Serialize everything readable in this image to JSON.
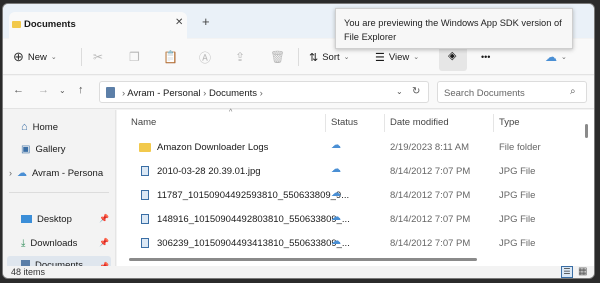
{
  "tab": {
    "title": "Documents",
    "close": "✕",
    "new_tab": "+"
  },
  "tooltip": {
    "text": "You are previewing the Windows App SDK version of File Explorer"
  },
  "toolbar": {
    "new_label": "New",
    "sort_label": "Sort",
    "view_label": "View",
    "more": "•••"
  },
  "address": {
    "back": "←",
    "forward": "→",
    "up": "↑",
    "crumb1": "Avram - Personal",
    "crumb2": "Documents",
    "search_placeholder": "Search Documents"
  },
  "sidebar": {
    "items": [
      {
        "label": "Home"
      },
      {
        "label": "Gallery"
      },
      {
        "label": "Avram - Persona"
      },
      {
        "label": "Desktop"
      },
      {
        "label": "Downloads"
      },
      {
        "label": "Documents"
      }
    ]
  },
  "columns": {
    "name": "Name",
    "status": "Status",
    "date": "Date modified",
    "type": "Type"
  },
  "files": [
    {
      "name": "Amazon Downloader Logs",
      "date": "2/19/2023 8:11 AM",
      "type": "File folder"
    },
    {
      "name": "2010-03-28 20.39.01.jpg",
      "date": "8/14/2012 7:07 PM",
      "type": "JPG File"
    },
    {
      "name": "11787_10150904492593810_550633809_9...",
      "date": "8/14/2012 7:07 PM",
      "type": "JPG File"
    },
    {
      "name": "148916_10150904492803810_550633809_...",
      "date": "8/14/2012 7:07 PM",
      "type": "JPG File"
    },
    {
      "name": "306239_10150904493413810_550633809_...",
      "date": "8/14/2012 7:07 PM",
      "type": "JPG File"
    }
  ],
  "status_bar": {
    "count": "48 items"
  },
  "colors": {
    "accent": "#0067c0",
    "folder": "#f2c94c",
    "cloud": "#4a8fd4"
  }
}
